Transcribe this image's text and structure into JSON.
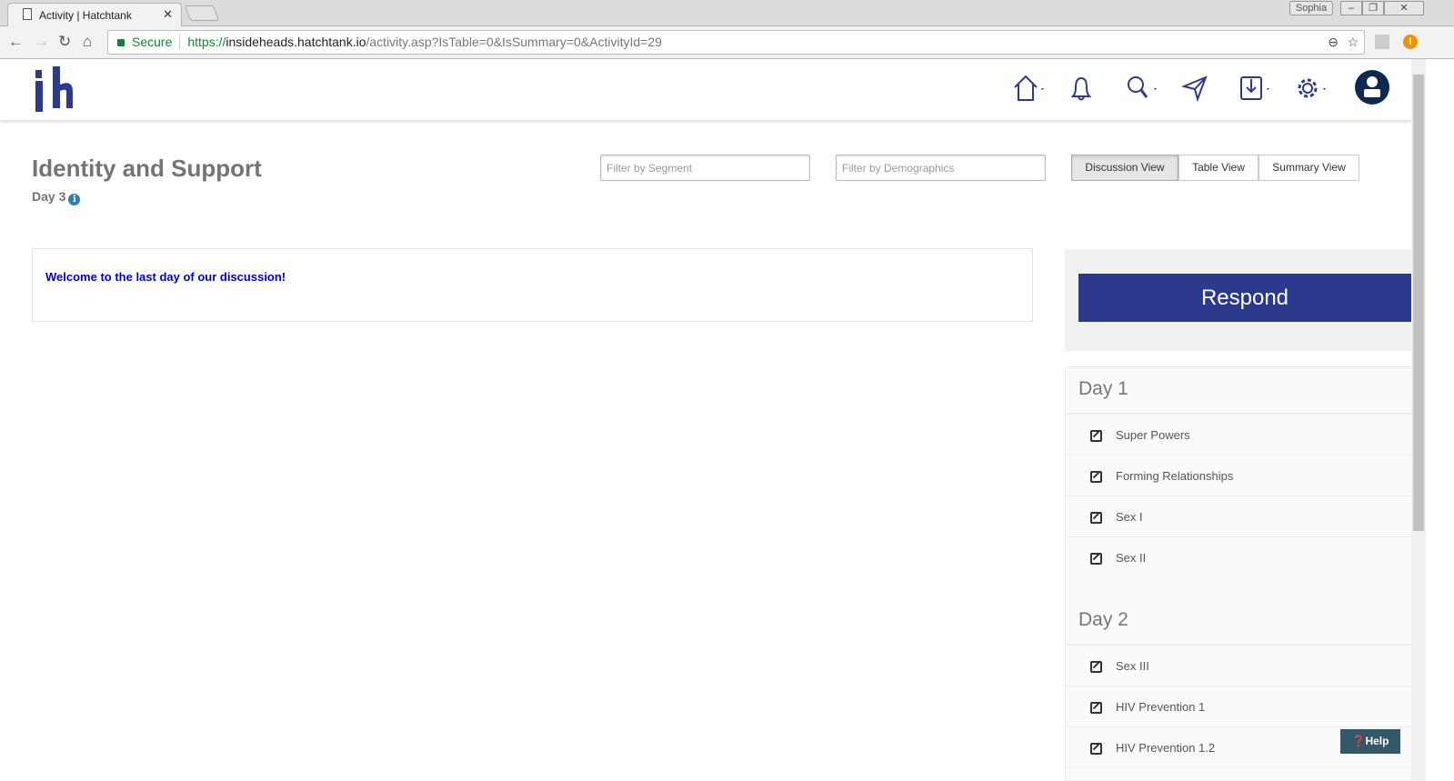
{
  "browser": {
    "tab_title": "Activity | Hatchtank",
    "profile": "Sophia",
    "secure_label": "Secure",
    "url_scheme": "https://",
    "url_host": "insideheads.hatchtank.io",
    "url_path": "/activity.asp?IsTable=0&IsSummary=0&ActivityId=29"
  },
  "page": {
    "title": "Identity and Support",
    "day": "Day 3",
    "info_glyph": "i"
  },
  "filters": {
    "segment_placeholder": "Filter by Segment",
    "demographics_placeholder": "Filter by Demographics"
  },
  "views": [
    {
      "label": "Discussion View",
      "active": true
    },
    {
      "label": "Table View"
    },
    {
      "label": "Summary View"
    }
  ],
  "intro": "Welcome to the last day of our discussion!",
  "respond_label": "Respond",
  "days": [
    {
      "label": "Day 1",
      "items": [
        "Super Powers",
        "Forming Relationships",
        "Sex I",
        "Sex II"
      ]
    },
    {
      "label": "Day 2",
      "items": [
        "Sex III",
        "HIV Prevention 1",
        "HIV Prevention 1.2"
      ]
    }
  ],
  "help_label": "Help",
  "colors": {
    "brand": "#2b3a8c",
    "help": "#355869",
    "intro": "#0000cc"
  }
}
